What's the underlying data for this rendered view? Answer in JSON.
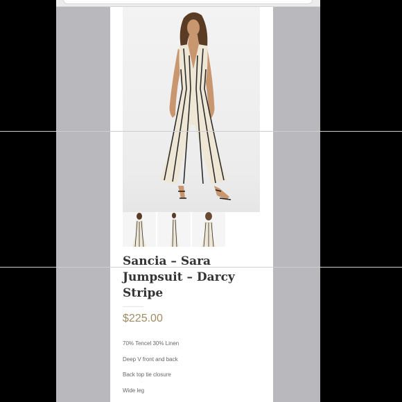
{
  "product": {
    "title": "Sancia – Sara Jumpsuit – Darcy Stripe",
    "price": "$225.00",
    "features": [
      "70% Tencel 30% Linen",
      "Deep V front and back",
      "Back top tie closure",
      "Wide leg"
    ]
  },
  "icons": {
    "hero": "model-photo-jumpsuit",
    "thumbs": [
      "front-view-thumbnail",
      "side-view-thumbnail",
      "back-view-thumbnail"
    ]
  },
  "colors": {
    "price": "#a08a63",
    "title": "#333333",
    "backdrop": "#b9b8bd",
    "stripe": "#2b2b2b",
    "fabric": "#efe7d5"
  }
}
